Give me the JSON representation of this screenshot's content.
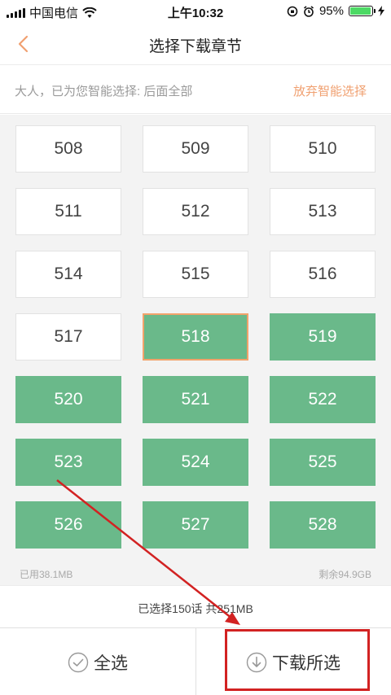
{
  "status": {
    "carrier": "中国电信",
    "time": "上午10:32",
    "battery": "95%",
    "battery_level": 0.95
  },
  "nav": {
    "title": "选择下载章节"
  },
  "smart": {
    "text": "大人，已为您智能选择: 后面全部",
    "cancel": "放弃智能选择"
  },
  "chapters": [
    {
      "num": "508",
      "selected": false
    },
    {
      "num": "509",
      "selected": false
    },
    {
      "num": "510",
      "selected": false
    },
    {
      "num": "511",
      "selected": false
    },
    {
      "num": "512",
      "selected": false
    },
    {
      "num": "513",
      "selected": false
    },
    {
      "num": "514",
      "selected": false
    },
    {
      "num": "515",
      "selected": false
    },
    {
      "num": "516",
      "selected": false
    },
    {
      "num": "517",
      "selected": false
    },
    {
      "num": "518",
      "selected": true,
      "focused": true
    },
    {
      "num": "519",
      "selected": true
    },
    {
      "num": "520",
      "selected": true
    },
    {
      "num": "521",
      "selected": true
    },
    {
      "num": "522",
      "selected": true
    },
    {
      "num": "523",
      "selected": true
    },
    {
      "num": "524",
      "selected": true
    },
    {
      "num": "525",
      "selected": true
    },
    {
      "num": "526",
      "selected": true
    },
    {
      "num": "527",
      "selected": true
    },
    {
      "num": "528",
      "selected": true
    }
  ],
  "storage": {
    "used": "已用38.1MB",
    "remaining": "剩余94.9GB"
  },
  "summary": "已选择150话 共251MB",
  "bottom": {
    "select_all": "全选",
    "download_selected": "下载所选"
  },
  "colors": {
    "selected": "#6ab98a",
    "accent": "#f0a070",
    "annotation": "#d22222"
  }
}
